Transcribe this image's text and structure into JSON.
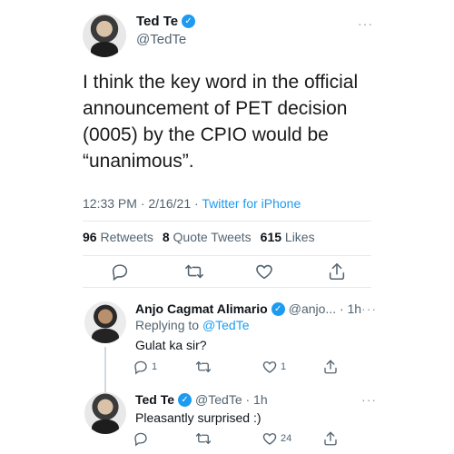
{
  "main": {
    "name": "Ted Te",
    "handle": "@TedTe",
    "verified_glyph": "✓",
    "more": "···",
    "text": "I think the key word in the official announcement of PET decision (0005) by the CPIO would be “unanimous”.",
    "time": "12:33 PM",
    "sep1": "·",
    "date": "2/16/21",
    "sep2": "·",
    "source": "Twitter for iPhone",
    "retweets_count": "96",
    "retweets_label": "Retweets",
    "quotes_count": "8",
    "quotes_label": "Quote Tweets",
    "likes_count": "615",
    "likes_label": "Likes"
  },
  "replies": [
    {
      "name": "Anjo Cagmat Alimario",
      "meta": "@anjo... · 1h",
      "replying_prefix": "Replying to",
      "replying_to": "@TedTe",
      "text": "Gulat ka sir?",
      "reply_count": "1",
      "retweet_count": "",
      "like_count": "1"
    },
    {
      "name": "Ted Te",
      "meta": "@TedTe · 1h",
      "text": "Pleasantly surprised :)",
      "reply_count": "",
      "retweet_count": "",
      "like_count": "24"
    }
  ],
  "icons": {
    "reply": "reply-icon",
    "retweet": "retweet-icon",
    "like": "like-icon",
    "share": "share-icon"
  },
  "colors": {
    "accent": "#1d9bf0",
    "muted": "#536471",
    "text": "#0f1419"
  }
}
